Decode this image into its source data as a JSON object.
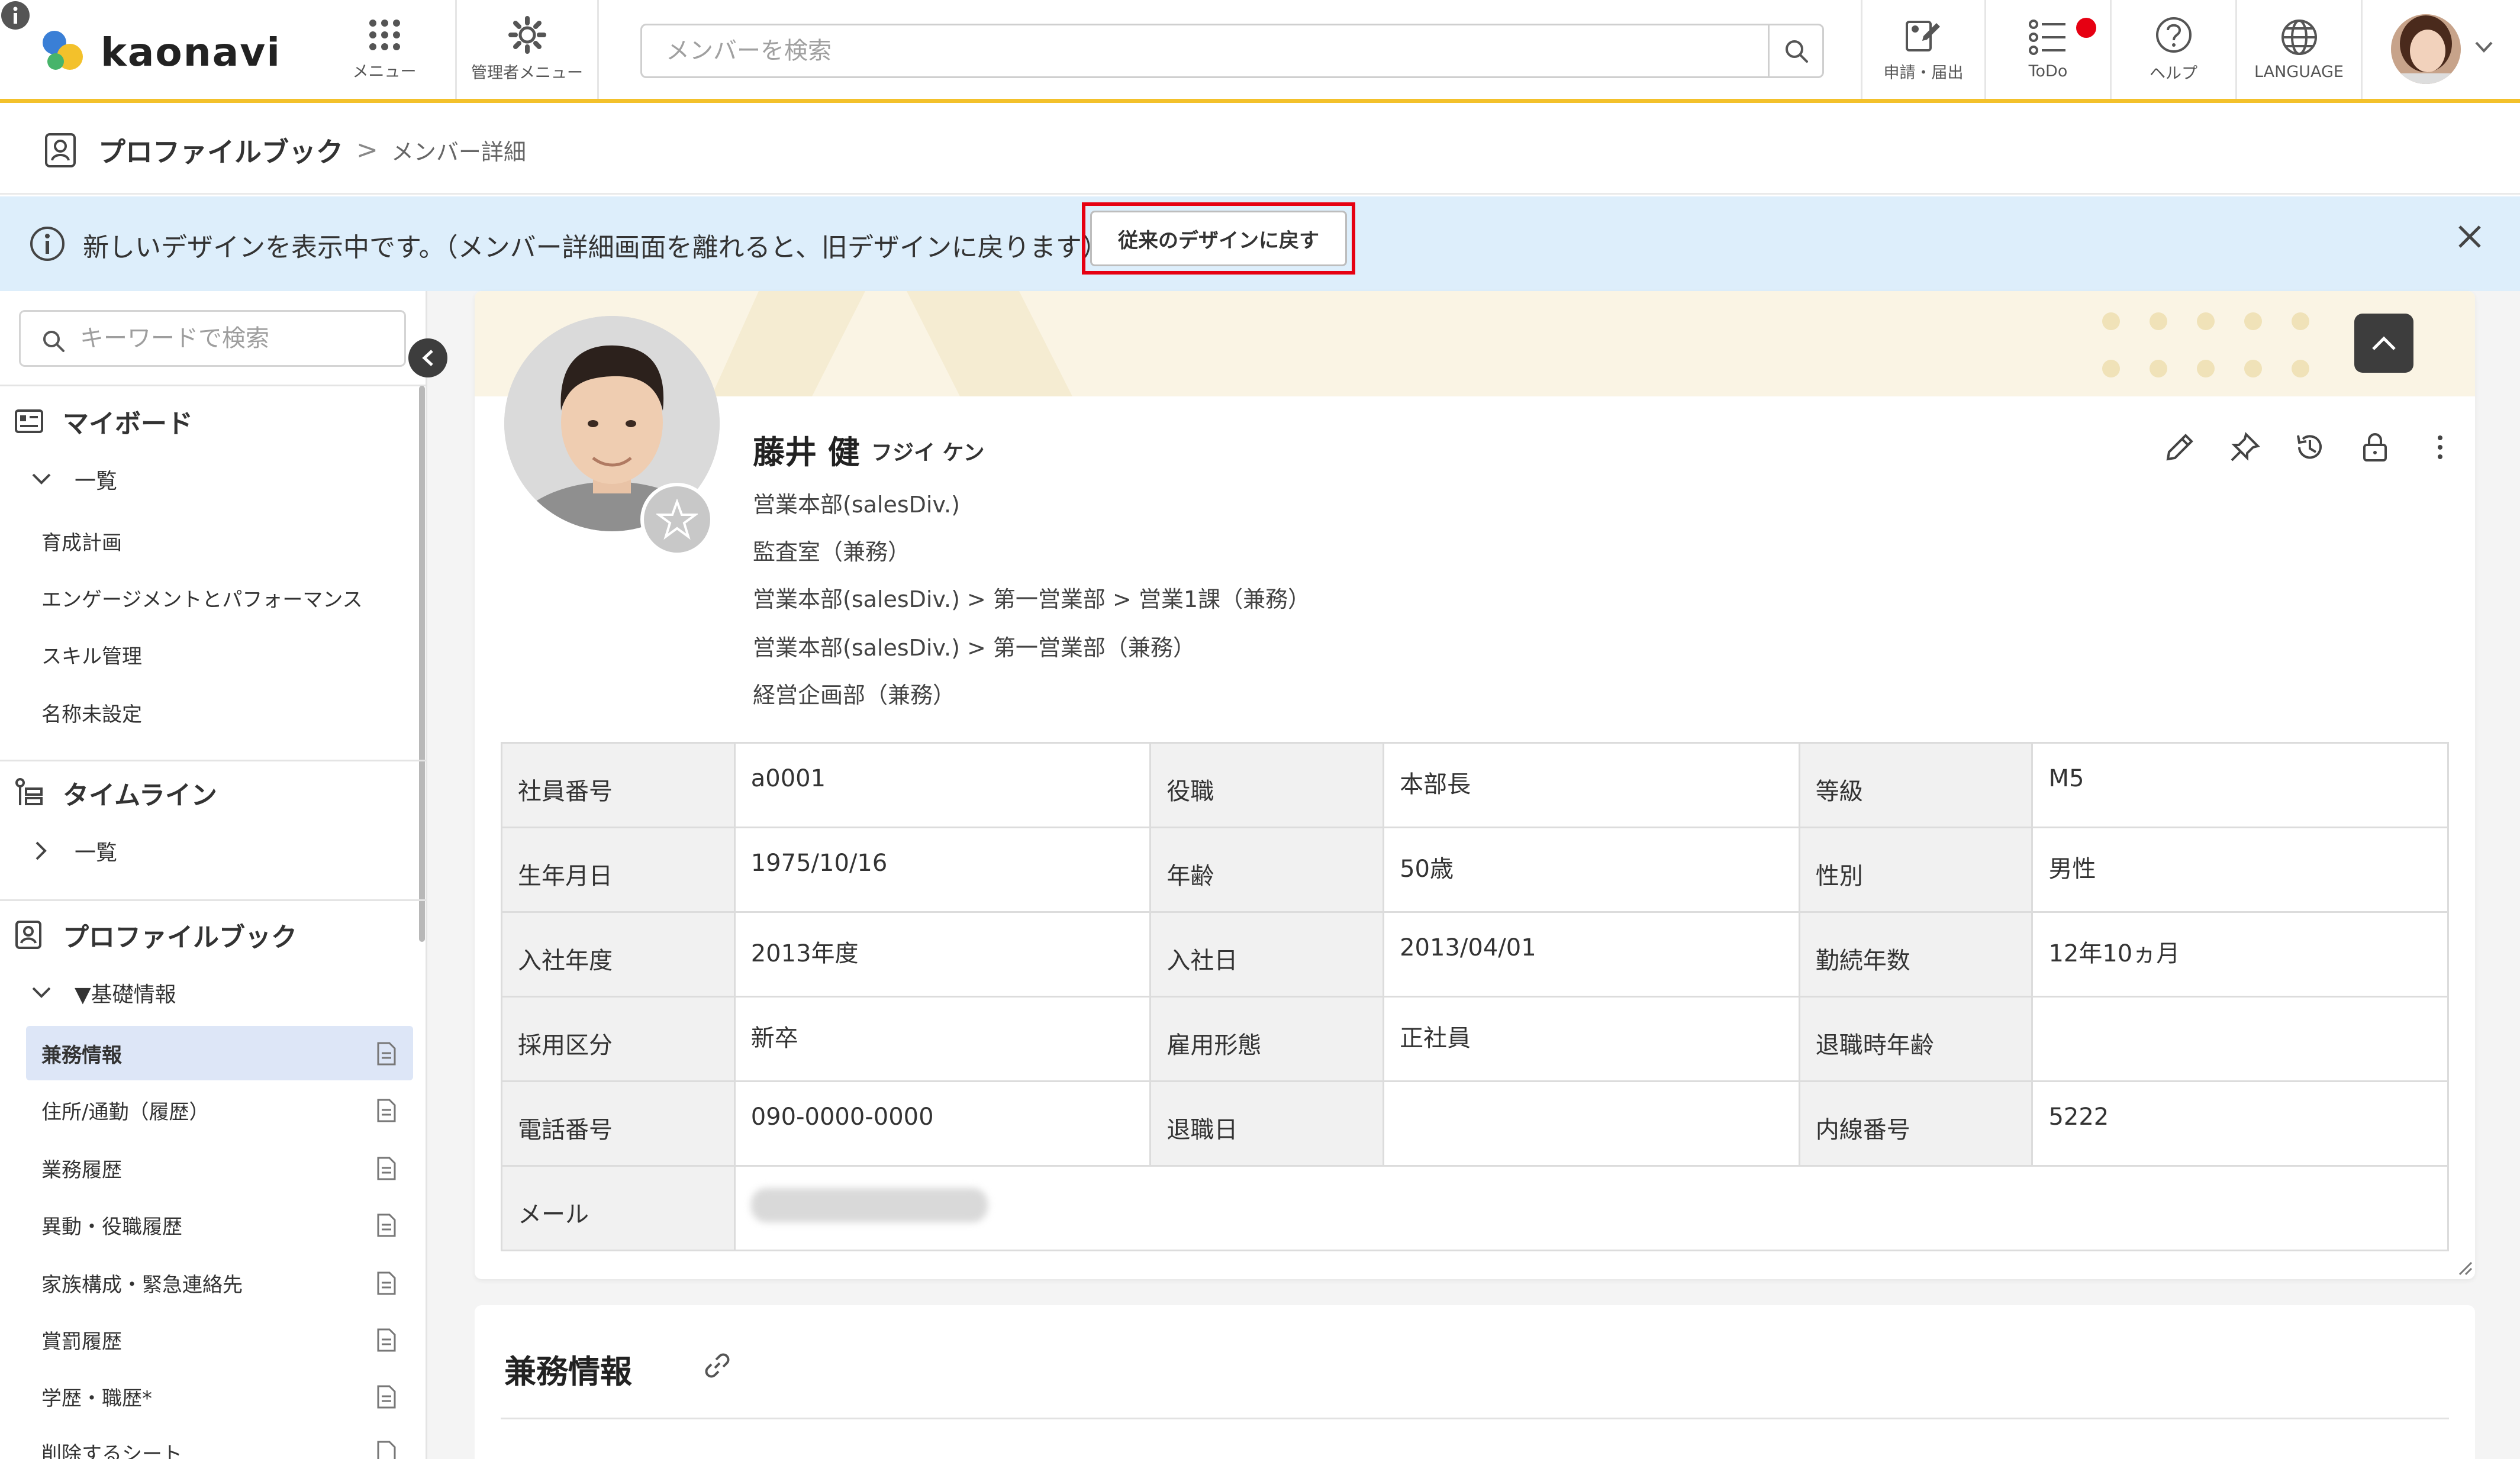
{
  "header": {
    "logo_text": "kaonavi",
    "menu_label": "メニュー",
    "admin_menu_label": "管理者メニュー",
    "search_placeholder": "メンバーを検索",
    "apply_label": "申請・届出",
    "todo_label": "ToDo",
    "help_label": "ヘルプ",
    "language_label": "LANGUAGE",
    "todo_badge_color": "#e60012"
  },
  "breadcrumb": {
    "root": "プロファイルブック",
    "separator": ">",
    "current": "メンバー詳細"
  },
  "notice": {
    "message": "新しいデザインを表示中です。（メンバー詳細画面を離れると、旧デザインに戻ります）",
    "revert_button": "従来のデザインに戻す",
    "highlight_color": "#e60012"
  },
  "sidebar": {
    "search_placeholder": "キーワードで検索",
    "myboard": {
      "title": "マイボード",
      "group": "一覧",
      "items": [
        "育成計画",
        "エンゲージメントとパフォーマンス",
        "スキル管理",
        "名称未設定"
      ]
    },
    "timeline": {
      "title": "タイムライン",
      "group": "一覧"
    },
    "profilebook": {
      "title": "プロファイルブック",
      "group": "▼基礎情報",
      "items": [
        "兼務情報",
        "住所/通勤（履歴）",
        "業務履歴",
        "異動・役職履歴",
        "家族構成・緊急連絡先",
        "賞罰履歴",
        "学歴・職歴*",
        "削除するシート"
      ],
      "active_index": 0
    }
  },
  "profile": {
    "name": "藤井 健",
    "kana": "フジイ ケン",
    "departments": [
      "営業本部(salesDiv.)",
      "監査室（兼務）",
      "営業本部(salesDiv.) > 第一営業部 > 営業1課（兼務）",
      "営業本部(salesDiv.) > 第一営業部（兼務）",
      "経営企画部（兼務）"
    ]
  },
  "info_table": [
    [
      [
        "社員番号",
        "a0001"
      ],
      [
        "役職",
        "本部長"
      ],
      [
        "等級",
        "M5"
      ]
    ],
    [
      [
        "生年月日",
        "1975/10/16"
      ],
      [
        "年齢",
        "50歳"
      ],
      [
        "性別",
        "男性"
      ]
    ],
    [
      [
        "入社年度",
        "2013年度"
      ],
      [
        "入社日",
        "2013/04/01"
      ],
      [
        "勤続年数",
        "12年10ヵ月"
      ]
    ],
    [
      [
        "採用区分",
        "新卒"
      ],
      [
        "雇用形態",
        "正社員"
      ],
      [
        "退職時年齢",
        ""
      ]
    ],
    [
      [
        "電話番号",
        "090-0000-0000"
      ],
      [
        "退職日",
        ""
      ],
      [
        "内線番号",
        "5222"
      ]
    ]
  ],
  "mail_label": "メール",
  "section2": {
    "title": "兼務情報"
  },
  "colors": {
    "header_accent": "#f3c12b",
    "notice_bg": "#ddeefb",
    "active_item_bg": "#dde6f7",
    "banner_bg": "#faf4e4"
  }
}
